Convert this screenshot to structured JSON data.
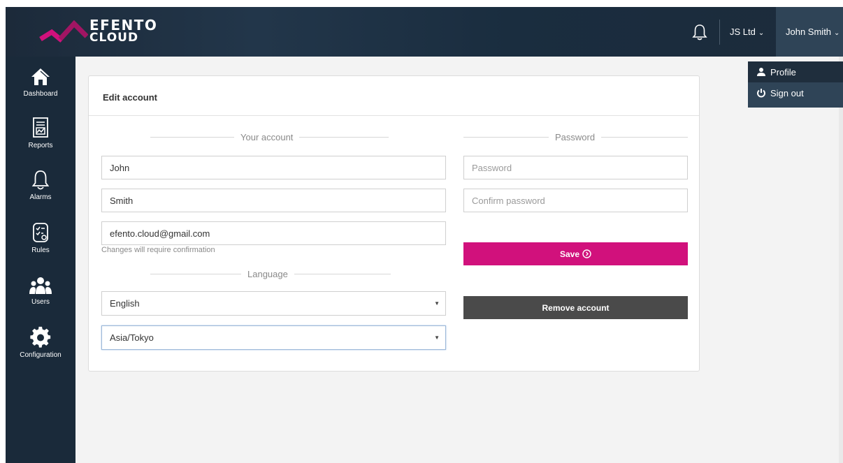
{
  "header": {
    "brand_line1": "EFENTO",
    "brand_line2": "CLOUD",
    "company": "JS Ltd",
    "user": "John Smith",
    "colors": {
      "accent": "#d1117c",
      "header_bg": "#1c2a3a",
      "sidebar_bg": "#1a2a3a"
    }
  },
  "user_menu": {
    "items": [
      {
        "label": "Profile",
        "icon": "user-icon"
      },
      {
        "label": "Sign out",
        "icon": "power-icon"
      }
    ]
  },
  "sidebar": {
    "items": [
      {
        "label": "Dashboard",
        "icon": "home-icon"
      },
      {
        "label": "Reports",
        "icon": "report-icon"
      },
      {
        "label": "Alarms",
        "icon": "bell-icon"
      },
      {
        "label": "Rules",
        "icon": "rules-icon"
      },
      {
        "label": "Users",
        "icon": "users-icon"
      },
      {
        "label": "Configuration",
        "icon": "gear-icon"
      }
    ]
  },
  "form": {
    "title": "Edit account",
    "account_section": "Your account",
    "password_section": "Password",
    "language_section": "Language",
    "first_name": "John",
    "last_name": "Smith",
    "email": "efento.cloud@gmail.com",
    "email_hint": "Changes will require confirmation",
    "password_placeholder": "Password",
    "confirm_placeholder": "Confirm password",
    "language": "English",
    "timezone": "Asia/Tokyo",
    "save_label": "Save",
    "remove_label": "Remove account"
  }
}
